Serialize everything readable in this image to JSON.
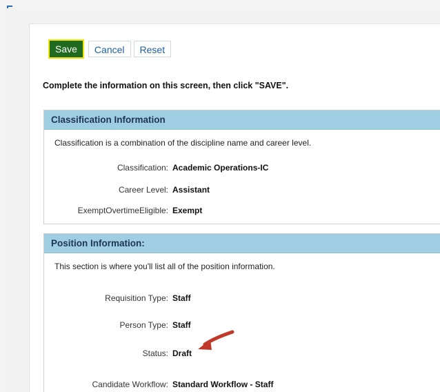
{
  "toolbar": {
    "save_label": "Save",
    "cancel_label": "Cancel",
    "reset_label": "Reset"
  },
  "instruction": "Complete the information on this screen, then click \"SAVE\".",
  "classification": {
    "header": "Classification Information",
    "description": "Classification is a combination of the discipline name and career level.",
    "fields": [
      {
        "label": "Classification:",
        "value": "Academic Operations-IC"
      },
      {
        "label": "Career Level:",
        "value": "Assistant"
      },
      {
        "label": "ExemptOvertimeEligible:",
        "value": "Exempt"
      }
    ]
  },
  "position": {
    "header": "Position Information:",
    "description": "This section is where you'll list all of the position information.",
    "fields": [
      {
        "label": "Requisition Type:",
        "value": "Staff"
      },
      {
        "label": "Person Type:",
        "value": "Staff"
      },
      {
        "label": "Status:",
        "value": "Draft"
      },
      {
        "label": "Candidate Workflow:",
        "value": "Standard Workflow - Staff"
      }
    ]
  },
  "colors": {
    "save_bg": "#1f6a1f",
    "save_border": "#f2e600",
    "section_header_bg": "#9fcde2",
    "annotation_arrow": "#c0392b"
  },
  "icons": {
    "annotation": "red-arrow-icon"
  }
}
